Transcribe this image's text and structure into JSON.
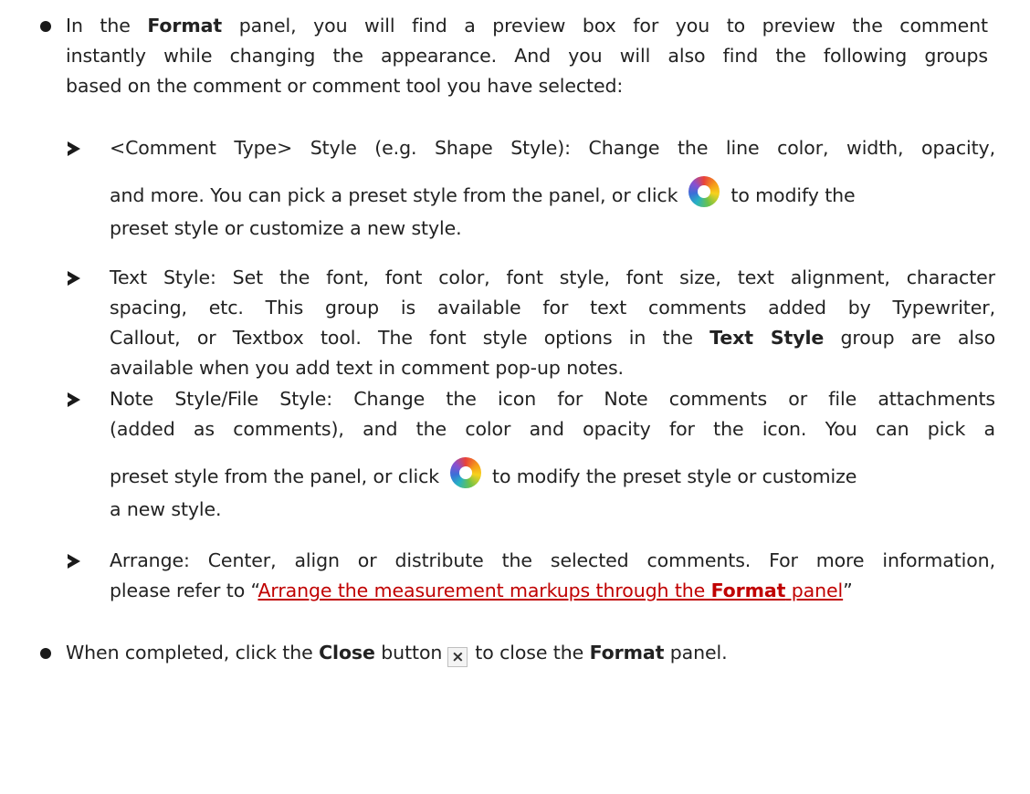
{
  "bullet1": {
    "lines": [
      [
        "In the ",
        "Format",
        " panel, you will find a preview box for you to preview the comment"
      ],
      "instantly while changing the appearance. And you will also find the following groups",
      "based on the comment or comment tool you have selected:"
    ]
  },
  "sub1": {
    "line1": "<Comment Type> Style (e.g. Shape Style): Change the line color, width, opacity,",
    "line2_before": "and more. You can pick a preset style from the panel, or click",
    "line2_after": "to modify the",
    "line3": "preset style or customize a new style.",
    "icon": "color-wheel-icon"
  },
  "sub2": {
    "line1": "Text Style: Set the font, font color, font style, font size, text alignment, character",
    "line2": "spacing, etc. This group is available for text comments added by Typewriter,",
    "line3_before": "Callout, or Textbox tool. The font style options in the",
    "line3_bold": "Text Style",
    "line3_after": "group are also",
    "line4": "available when you add text in comment pop-up notes."
  },
  "sub3": {
    "line1": "Note Style/File Style: Change the icon for Note comments or file attachments",
    "line2": "(added as comments), and the color and opacity for the icon. You can pick a",
    "line3_before": "preset style from the panel, or click",
    "line3_after": "to modify the preset style or customize",
    "line4": "a new style.",
    "icon": "color-wheel-icon"
  },
  "sub4": {
    "line1": "Arrange: Center, align or distribute the selected comments. For more information,",
    "line2_before": "please refer to “",
    "link_text": "Arrange the measurement markups through the ",
    "link_bold": "Format",
    "link_after": " panel",
    "line2_after": "”"
  },
  "bullet2": {
    "before": "When completed, click the ",
    "bold1": "Close",
    "middle1": " button",
    "close_icon": "×",
    "middle2": "to close the ",
    "bold2": "Format",
    "after": " panel."
  },
  "colors": {
    "link": "#c00000",
    "text": "#222222"
  }
}
